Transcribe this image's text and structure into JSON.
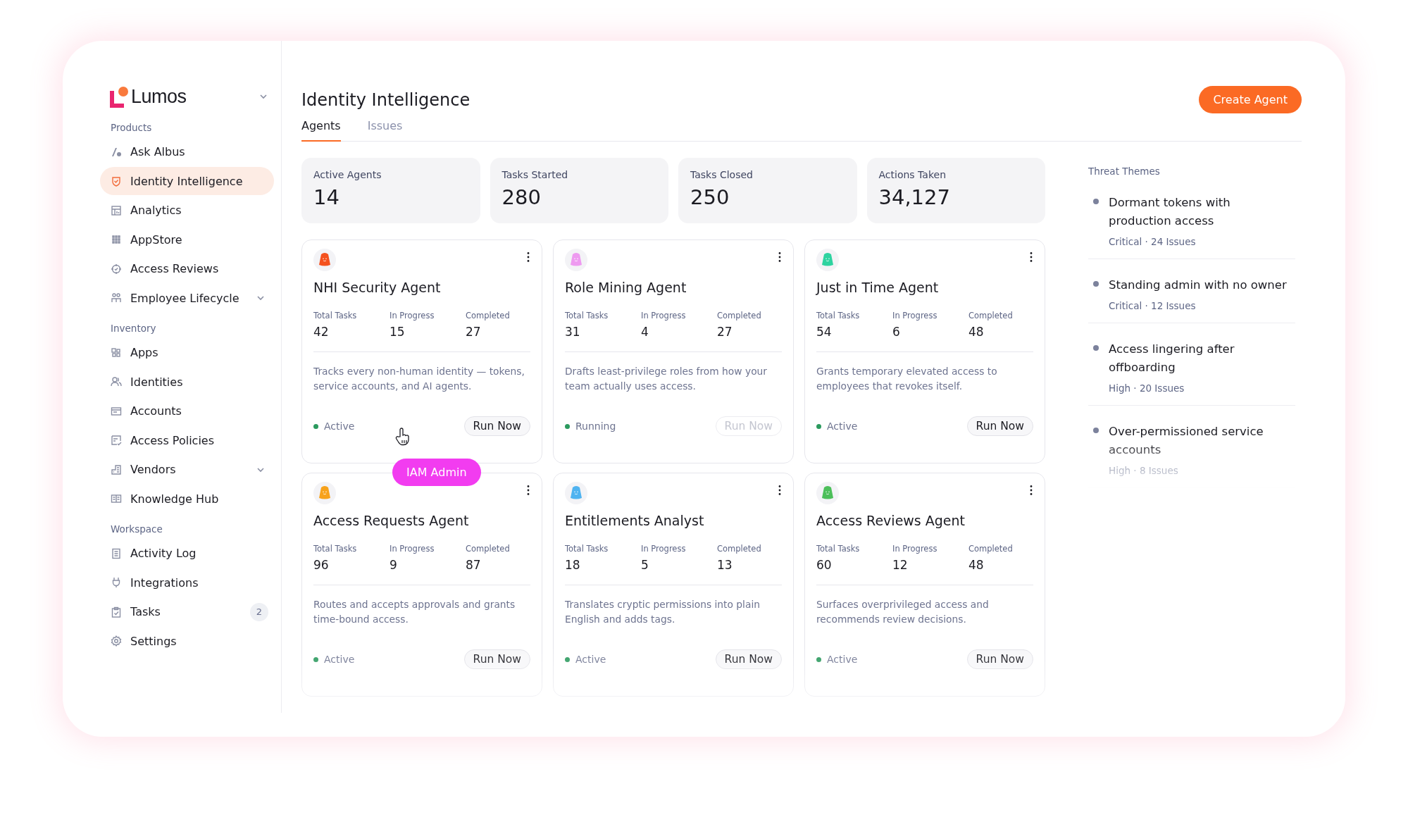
{
  "brand": {
    "name": "Lumos"
  },
  "sidebar": {
    "sections": [
      {
        "label": "Products",
        "items": [
          {
            "label": "Ask Albus",
            "selected": false,
            "expandable": false
          },
          {
            "label": "Identity Intelligence",
            "selected": true,
            "expandable": false
          },
          {
            "label": "Analytics",
            "selected": false,
            "expandable": false
          },
          {
            "label": "AppStore",
            "selected": false,
            "expandable": false
          },
          {
            "label": "Access Reviews",
            "selected": false,
            "expandable": false
          },
          {
            "label": "Employee Lifecycle",
            "selected": false,
            "expandable": true
          }
        ]
      },
      {
        "label": "Inventory",
        "items": [
          {
            "label": "Apps",
            "selected": false,
            "expandable": false
          },
          {
            "label": "Identities",
            "selected": false,
            "expandable": false
          },
          {
            "label": "Accounts",
            "selected": false,
            "expandable": false
          },
          {
            "label": "Access Policies",
            "selected": false,
            "expandable": false
          },
          {
            "label": "Vendors",
            "selected": false,
            "expandable": true
          },
          {
            "label": "Knowledge Hub",
            "selected": false,
            "expandable": false
          }
        ]
      },
      {
        "label": "Workspace",
        "items": [
          {
            "label": "Activity Log",
            "selected": false,
            "expandable": false
          },
          {
            "label": "Integrations",
            "selected": false,
            "expandable": false
          },
          {
            "label": "Tasks",
            "selected": false,
            "expandable": false,
            "badge": "2"
          },
          {
            "label": "Settings",
            "selected": false,
            "expandable": false
          }
        ]
      }
    ]
  },
  "header": {
    "title": "Identity Intelligence",
    "action": "Create Agent"
  },
  "tabs": [
    {
      "label": "Agents",
      "selected": true
    },
    {
      "label": "Issues",
      "selected": false
    }
  ],
  "stats": [
    {
      "label": "Active Agents",
      "value": "14"
    },
    {
      "label": "Tasks Started",
      "value": "280"
    },
    {
      "label": "Tasks Closed",
      "value": "250"
    },
    {
      "label": "Actions Taken",
      "value": "34,127"
    }
  ],
  "agents": [
    {
      "name": "NHI Security Agent",
      "color": "#f4511e",
      "metrics": [
        {
          "label": "Total Tasks",
          "value": "42"
        },
        {
          "label": "In Progress",
          "value": "15"
        },
        {
          "label": "Completed",
          "value": "27"
        }
      ],
      "description": "Tracks every non-human identity — tokens, service accounts, and AI agents.",
      "status": "Active",
      "action": {
        "label": "Run Now",
        "disabled": false
      }
    },
    {
      "name": "Role Mining Agent",
      "color": "#ee9af0",
      "metrics": [
        {
          "label": "Total Tasks",
          "value": "31"
        },
        {
          "label": "In Progress",
          "value": "4"
        },
        {
          "label": "Completed",
          "value": "27"
        }
      ],
      "description": "Drafts least-privilege roles from how your team actually uses access.",
      "status": "Running",
      "action": {
        "label": "Run Now",
        "disabled": true
      }
    },
    {
      "name": "Just in Time Agent",
      "color": "#2ed3a0",
      "metrics": [
        {
          "label": "Total Tasks",
          "value": "54"
        },
        {
          "label": "In Progress",
          "value": "6"
        },
        {
          "label": "Completed",
          "value": "48"
        }
      ],
      "description": "Grants temporary elevated access to employees that revokes itself.",
      "status": "Active",
      "action": {
        "label": "Run Now",
        "disabled": false
      }
    },
    {
      "name": "Access Requests Agent",
      "color": "#f7a21b",
      "metrics": [
        {
          "label": "Total Tasks",
          "value": "96"
        },
        {
          "label": "In Progress",
          "value": "9"
        },
        {
          "label": "Completed",
          "value": "87"
        }
      ],
      "description": "Routes and accepts approvals and grants time-bound access.",
      "status": "Active",
      "action": {
        "label": "Run Now",
        "disabled": false
      }
    },
    {
      "name": "Entitlements Analyst",
      "color": "#4fb3f0",
      "metrics": [
        {
          "label": "Total Tasks",
          "value": "18"
        },
        {
          "label": "In Progress",
          "value": "5"
        },
        {
          "label": "Completed",
          "value": "13"
        }
      ],
      "description": "Translates cryptic permissions into plain English and adds tags.",
      "status": "Active",
      "action": {
        "label": "Run Now",
        "disabled": false
      }
    },
    {
      "name": "Access Reviews Agent",
      "color": "#4cbf5a",
      "metrics": [
        {
          "label": "Total Tasks",
          "value": "60"
        },
        {
          "label": "In Progress",
          "value": "12"
        },
        {
          "label": "Completed",
          "value": "48"
        }
      ],
      "description": "Surfaces overprivileged access and recommends review decisions.",
      "status": "Active",
      "action": {
        "label": "Run Now",
        "disabled": false
      }
    }
  ],
  "user_badge": {
    "label": "IAM Admin"
  },
  "threat_themes": {
    "title": "Threat Themes",
    "items": [
      {
        "title": "Dormant tokens with production access",
        "meta": "Critical · 24 Issues"
      },
      {
        "title": "Standing admin with no owner",
        "meta": "Critical · 12 Issues"
      },
      {
        "title": "Access lingering after offboarding",
        "meta": "High · 20 Issues"
      },
      {
        "title": "Over-permissioned service accounts",
        "meta": "High · 8 Issues"
      }
    ]
  }
}
